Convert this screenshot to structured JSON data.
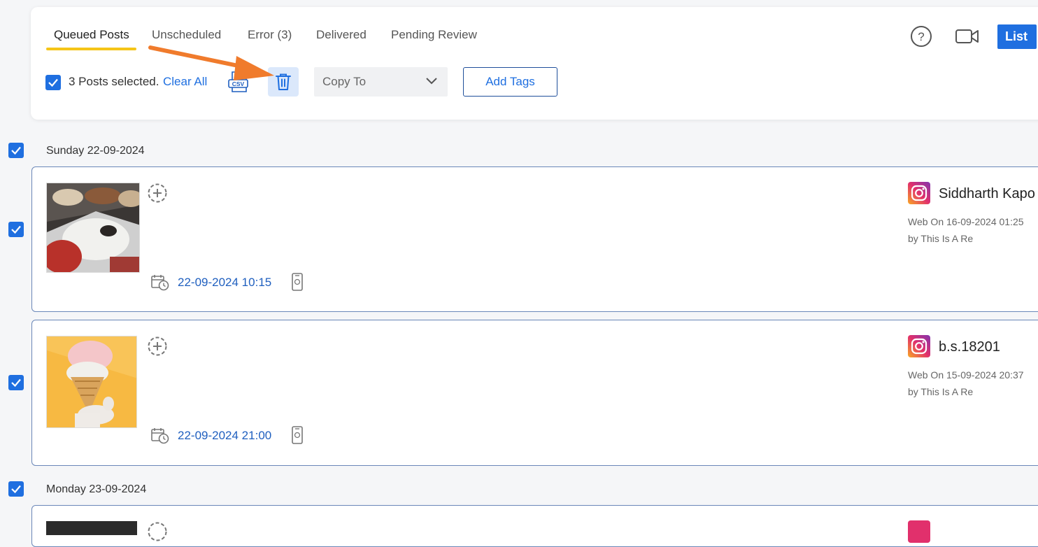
{
  "tabs": [
    {
      "label": "Queued Posts",
      "active": true
    },
    {
      "label": "Unscheduled"
    },
    {
      "label": "Error (3)"
    },
    {
      "label": "Delivered"
    },
    {
      "label": "Pending Review"
    }
  ],
  "selection": {
    "text": "3 Posts selected.",
    "clear_label": "Clear All"
  },
  "toolbar": {
    "csv_icon": "csv-export-icon",
    "delete_icon": "trash-icon",
    "copy_to_label": "Copy To",
    "add_tags_label": "Add Tags",
    "list_label": "List"
  },
  "colors": {
    "accent": "#1f6fe0",
    "tab_underline": "#f5c518",
    "arrow": "#f07b2c",
    "instagram": "#e1306c"
  },
  "groups": [
    {
      "date": "Sunday 22-09-2024",
      "posts": [
        {
          "time": "22-09-2024 10:15",
          "account": "Siddharth Kapo",
          "source": "Web On 16-09-2024 01:25",
          "author": "by This Is A Re",
          "thumb": "gelato-trays"
        },
        {
          "time": "22-09-2024 21:00",
          "account": "b.s.18201",
          "source": "Web On 15-09-2024 20:37",
          "author": "by This Is A Re",
          "thumb": "ice-cream-cone"
        }
      ]
    },
    {
      "date": "Monday 23-09-2024",
      "posts": []
    }
  ]
}
